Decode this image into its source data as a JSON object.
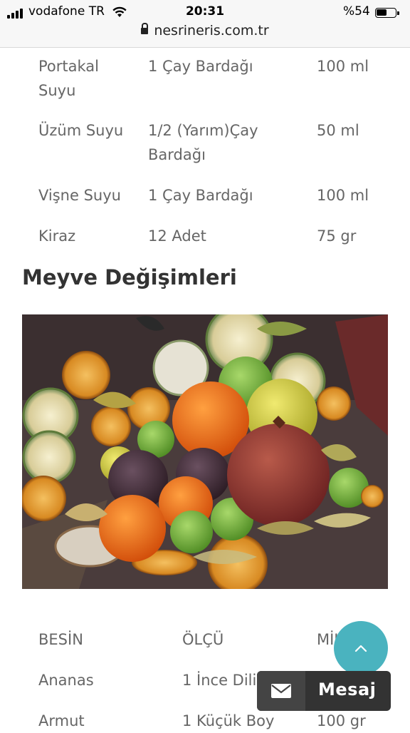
{
  "status_bar": {
    "carrier": "vodafone TR",
    "time": "20:31",
    "battery": "%54",
    "url": "nesrineris.com.tr"
  },
  "table1": {
    "rows": [
      {
        "name": [
          "Portakal",
          "Suyu"
        ],
        "measure": [
          "1 Çay Bardağı"
        ],
        "amount": "100 ml"
      },
      {
        "name": [
          "Üzüm Suyu"
        ],
        "measure": [
          "1/2 (Yarım)Çay",
          "Bardağı"
        ],
        "amount": "50 ml"
      },
      {
        "name": [
          "Vişne Suyu"
        ],
        "measure": [
          "1 Çay Bardağı"
        ],
        "amount": "100 ml"
      },
      {
        "name": [
          "Kiraz"
        ],
        "measure": [
          "12 Adet"
        ],
        "amount": "75 gr"
      }
    ]
  },
  "section": {
    "title": "Meyve Değişimleri"
  },
  "table2": {
    "headers": [
      "BESİN",
      "ÖLÇÜ",
      "MİKTAR"
    ],
    "rows": [
      {
        "name": "Ananas",
        "measure": "1 İnce Dilim",
        "amount": ""
      },
      {
        "name": "Armut",
        "measure": "1 Küçük Boy",
        "amount": "100 gr"
      }
    ]
  },
  "chat": {
    "label": "Mesaj",
    "icon": "envelope-icon"
  },
  "scroll_top": {
    "icon": "chevron-up-icon"
  },
  "colors": {
    "fab": "#4ab3bf",
    "chat_bg": "#333333"
  }
}
